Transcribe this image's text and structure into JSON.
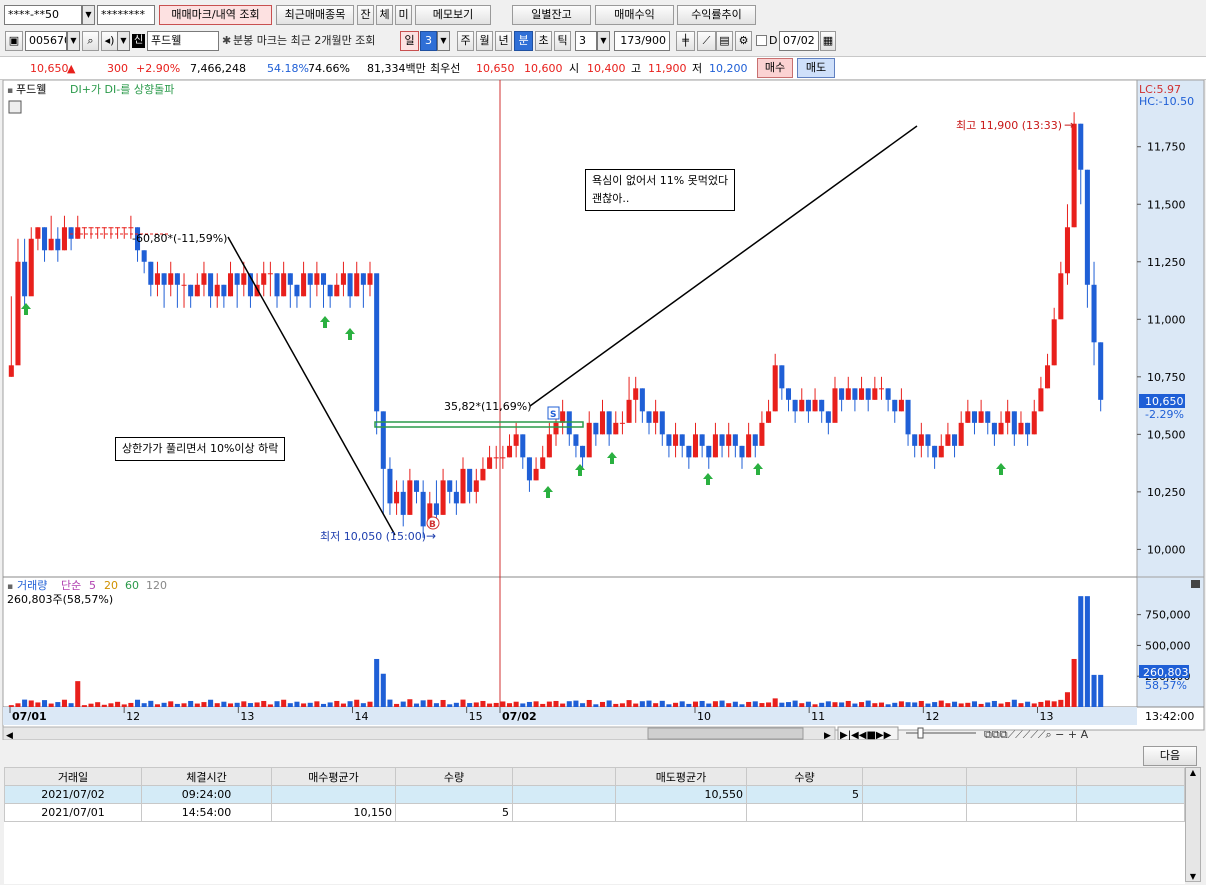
{
  "toolbar1": {
    "account": "****-**50",
    "password": "********",
    "buttons": [
      "매매마크/내역 조회",
      "최근매매종목",
      "잔",
      "체",
      "미",
      "메모보기",
      "일별잔고",
      "매매수익",
      "수익률추이"
    ]
  },
  "toolbar2": {
    "code": "005670",
    "credit_badge": "신",
    "stock_name": "푸드웰",
    "notice": "분봉 마크는 최근 2개월만 조회",
    "periods": [
      "일",
      "3",
      "주",
      "월",
      "년",
      "분",
      "초",
      "틱"
    ],
    "active_period": "분",
    "interval": "3",
    "count": "173/900",
    "date_checkbox_label": "D",
    "date": "07/02"
  },
  "quote": {
    "price": "10,650",
    "change": "300",
    "change_pct": "+2.90%",
    "volume": "7,466,248",
    "vol_ratio1": "54.18%",
    "vol_ratio2": "74.66%",
    "amount": "81,334백만",
    "best_label": "최우선",
    "ask": "10,650",
    "bid": "10,600",
    "open_label": "시",
    "open": "10,400",
    "high_label": "고",
    "high": "11,900",
    "low_label": "저",
    "low": "10,200",
    "buy_button": "매수",
    "sell_button": "매도"
  },
  "price_chart": {
    "title": "푸드웰",
    "indicator": "DI+가 DI-를 상향돌파",
    "lc": "LC:5.97",
    "hc": "HC:-10.50",
    "current_price": "10,650",
    "current_pct": "-2.29%",
    "high_label": "최고 11,900 (13:33)",
    "low_label": "최저 10,050 (15:00)",
    "trendline_label_1": "-60,80*(-11,59%)",
    "trendline_label_2": "35,82*(11,69%)",
    "buy_mark": "B",
    "sell_mark": "S",
    "annotations": [
      {
        "lines": [
          "상한가가 풀리면서 10%이상 하락"
        ]
      },
      {
        "lines": [
          "욕심이 없어서 11% 못먹었다",
          "괜찮아.."
        ]
      }
    ]
  },
  "volume_chart": {
    "title": "거래량",
    "ma_label": "단순",
    "ma_periods": [
      "5",
      "20",
      "60",
      "120"
    ],
    "current": "260,803주(58,57%)",
    "current_value": "260,803",
    "current_pct": "58,57%"
  },
  "time_axis": {
    "labels": [
      "07/01",
      "12",
      "13",
      "14",
      "15",
      "07/02",
      "10",
      "11",
      "12",
      "13"
    ],
    "clock": "13:42:00"
  },
  "next_button": "다음",
  "grid": {
    "headers": [
      "거래일",
      "체결시간",
      "매수평균가",
      "수량",
      "",
      "매도평균가",
      "수량",
      "",
      "",
      ""
    ],
    "rows": [
      [
        "2021/07/02",
        "09:24:00",
        "",
        "",
        "",
        "10,550",
        "5",
        "",
        "",
        ""
      ],
      [
        "2021/07/01",
        "14:54:00",
        "10,150",
        "5",
        "",
        "",
        "",
        "",
        "",
        ""
      ]
    ]
  },
  "chart_data": [
    {
      "type": "candlestick",
      "title": "",
      "interval": "3분",
      "y_axis_ticks": [
        10000,
        10250,
        10500,
        10750,
        11000,
        11250,
        11500,
        11750
      ],
      "ylim": [
        9880,
        12040
      ],
      "x_session_labels": [
        "07/01",
        "12",
        "13",
        "14",
        "15",
        "07/02",
        "10",
        "11",
        "12",
        "13"
      ],
      "series_close": [
        10800,
        11250,
        11100,
        11350,
        11400,
        11300,
        11350,
        11300,
        11400,
        11350,
        11400,
        11400,
        11400,
        11400,
        11400,
        11400,
        11400,
        11400,
        11400,
        11300,
        11250,
        11150,
        11200,
        11150,
        11200,
        11150,
        11150,
        11100,
        11150,
        11200,
        11100,
        11150,
        11100,
        11200,
        11150,
        11200,
        11100,
        11150,
        11200,
        11200,
        11100,
        11200,
        11150,
        11100,
        11200,
        11150,
        11200,
        11150,
        11100,
        11150,
        11200,
        11100,
        11200,
        11150,
        11200,
        10600,
        10350,
        10200,
        10250,
        10150,
        10300,
        10250,
        10100,
        10200,
        10150,
        10300,
        10250,
        10200,
        10350,
        10250,
        10300,
        10350,
        10400,
        10400,
        10400,
        10450,
        10500,
        10400,
        10300,
        10350,
        10400,
        10500,
        10550,
        10600,
        10500,
        10450,
        10400,
        10550,
        10500,
        10600,
        10500,
        10550,
        10550,
        10650,
        10700,
        10600,
        10550,
        10600,
        10500,
        10450,
        10500,
        10450,
        10400,
        10500,
        10450,
        10400,
        10500,
        10450,
        10500,
        10450,
        10400,
        10500,
        10450,
        10550,
        10600,
        10800,
        10700,
        10650,
        10600,
        10650,
        10600,
        10650,
        10600,
        10550,
        10700,
        10650,
        10700,
        10650,
        10700,
        10650,
        10700,
        10700,
        10650,
        10600,
        10650,
        10500,
        10450,
        10500,
        10450,
        10400,
        10450,
        10500,
        10450,
        10550,
        10600,
        10550,
        10600,
        10550,
        10500,
        10550,
        10600,
        10500,
        10550,
        10500,
        10600,
        10700,
        10800,
        11000,
        11200,
        11400,
        11850,
        11650,
        11150,
        10900,
        10650
      ],
      "series_high": [
        11100,
        11350,
        11350,
        11400,
        11400,
        11400,
        11450,
        11400,
        11450,
        11400,
        11450,
        11400,
        11400,
        11400,
        11400,
        11400,
        11400,
        11400,
        11450,
        11400,
        11300,
        11250,
        11250,
        11200,
        11250,
        11200,
        11200,
        11150,
        11200,
        11250,
        11150,
        11200,
        11150,
        11250,
        11200,
        11250,
        11200,
        11200,
        11250,
        11250,
        11200,
        11250,
        11200,
        11150,
        11250,
        11200,
        11250,
        11200,
        11150,
        11200,
        11250,
        11200,
        11250,
        11200,
        11250,
        11150,
        10600,
        10400,
        10300,
        10300,
        10350,
        10300,
        10300,
        10250,
        10300,
        10350,
        10300,
        10300,
        10400,
        10300,
        10350,
        10400,
        10450,
        10450,
        10450,
        10500,
        10550,
        10500,
        10400,
        10400,
        10450,
        10550,
        10600,
        10650,
        10550,
        10500,
        10450,
        10600,
        10550,
        10650,
        10600,
        10600,
        10600,
        10750,
        10750,
        10700,
        10600,
        10650,
        10550,
        10500,
        10550,
        10500,
        10450,
        10550,
        10500,
        10450,
        10550,
        10500,
        10550,
        10500,
        10450,
        10550,
        10500,
        10600,
        10650,
        10850,
        10800,
        10700,
        10650,
        10700,
        10650,
        10700,
        10650,
        10600,
        10750,
        10700,
        10750,
        10700,
        10750,
        10700,
        10750,
        10750,
        10700,
        10650,
        10700,
        10600,
        10500,
        10550,
        10500,
        10450,
        10500,
        10550,
        10500,
        10600,
        10650,
        10600,
        10650,
        10600,
        10550,
        10600,
        10650,
        10600,
        10600,
        10550,
        10650,
        10750,
        10850,
        11050,
        11250,
        11500,
        11900,
        11850,
        11650,
        11250,
        10900
      ],
      "series_low": [
        10750,
        11100,
        11050,
        11250,
        11300,
        11250,
        11300,
        11250,
        11300,
        11300,
        11350,
        11350,
        11350,
        11350,
        11350,
        11350,
        11350,
        11350,
        11350,
        11250,
        11200,
        11100,
        11100,
        11050,
        11100,
        11050,
        11050,
        11050,
        11100,
        11100,
        11050,
        11050,
        11050,
        11100,
        11050,
        11100,
        11050,
        11100,
        11100,
        11100,
        11050,
        11100,
        11050,
        11050,
        11100,
        11050,
        11100,
        11050,
        11050,
        11100,
        11100,
        11050,
        11100,
        11050,
        11100,
        10500,
        10150,
        10150,
        10150,
        10100,
        10150,
        10200,
        10050,
        10100,
        10100,
        10150,
        10200,
        10150,
        10200,
        10200,
        10200,
        10300,
        10350,
        10350,
        10350,
        10400,
        10400,
        10350,
        10250,
        10300,
        10350,
        10400,
        10450,
        10500,
        10450,
        10400,
        10350,
        10450,
        10450,
        10500,
        10450,
        10500,
        10500,
        10550,
        10550,
        10550,
        10500,
        10500,
        10450,
        10400,
        10400,
        10400,
        10350,
        10400,
        10400,
        10350,
        10400,
        10400,
        10400,
        10400,
        10350,
        10400,
        10400,
        10450,
        10550,
        10600,
        10650,
        10600,
        10550,
        10600,
        10550,
        10600,
        10550,
        10500,
        10600,
        10600,
        10650,
        10600,
        10650,
        10600,
        10650,
        10650,
        10600,
        10550,
        10600,
        10450,
        10400,
        10400,
        10400,
        10350,
        10400,
        10450,
        10400,
        10450,
        10550,
        10500,
        10550,
        10500,
        10450,
        10500,
        10500,
        10450,
        10500,
        10450,
        10500,
        10600,
        10700,
        10800,
        11000,
        11150,
        11400,
        11500,
        11050,
        10800,
        10600
      ]
    },
    {
      "type": "bar",
      "title": "",
      "y_axis_ticks": [
        250000,
        500000,
        750000
      ],
      "ylim": [
        0,
        950000
      ],
      "last_value": 260803,
      "last_pct": "58.57%",
      "series_sample": [
        120000,
        390000,
        900000,
        620000,
        260803
      ]
    }
  ],
  "colors": {
    "up": "#e8201c",
    "down": "#1f5fd6",
    "vline": "#d03030",
    "annotation_line": "#000000",
    "highlight_box": "#2a9a4a",
    "axis_panel": "#dbe8f6"
  }
}
